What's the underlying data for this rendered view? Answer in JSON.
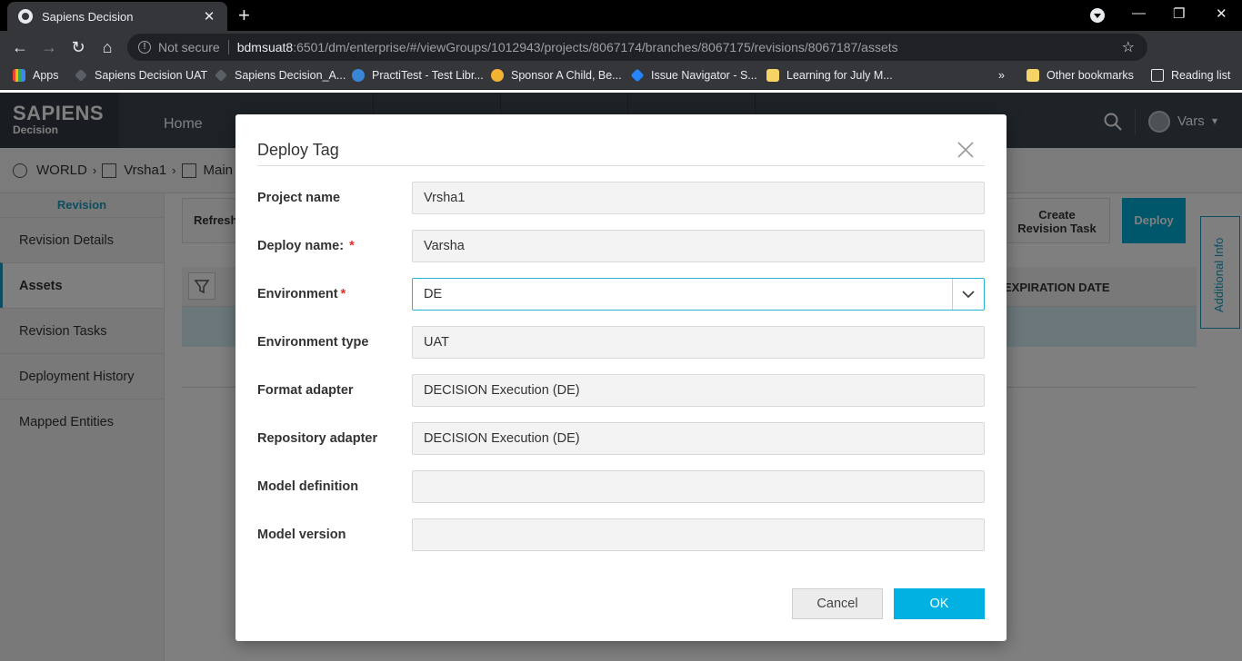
{
  "browser": {
    "tab_title": "Sapiens Decision",
    "url_warning": "Not secure",
    "url_host": "bdmsuat8",
    "url_rest": ":6501/dm/enterprise/#/viewGroups/1012943/projects/8067174/branches/8067175/revisions/8067187/assets",
    "bookmarks": [
      "Apps",
      "Sapiens Decision UAT",
      "Sapiens Decision_A...",
      "PractiTest - Test Libr...",
      "Sponsor A Child, Be...",
      "Issue Navigator - S...",
      "Learning for July M..."
    ],
    "more_bookmarks": "»",
    "other_bookmarks": "Other bookmarks",
    "reading_list": "Reading list"
  },
  "app": {
    "logo_top": "SAPIENS",
    "logo_bottom": "Decision",
    "nav_home": "Home",
    "user_name": "Vars",
    "breadcrumb": [
      "WORLD",
      "Vrsha1",
      "Main"
    ],
    "sidebar_header": "Revision",
    "sidebar_items": [
      "Revision Details",
      "Assets",
      "Revision Tasks",
      "Deployment History",
      "Mapped Entities"
    ],
    "refresh_label": "Refresh",
    "create_task_label": "Create\nRevision Task",
    "deploy_label": "Deploy",
    "additional_info": "Additional Info",
    "expiration_col": "EXPIRATION DATE"
  },
  "dialog": {
    "title": "Deploy Tag",
    "fields": {
      "project_name": {
        "label": "Project name",
        "value": "Vrsha1"
      },
      "deploy_name": {
        "label": "Deploy name:",
        "required": "*",
        "value": "Varsha"
      },
      "environment": {
        "label": "Environment",
        "required": "*",
        "value": "DE"
      },
      "environment_type": {
        "label": "Environment type",
        "value": "UAT"
      },
      "format_adapter": {
        "label": "Format adapter",
        "value": "DECISION Execution (DE)"
      },
      "repository_adapter": {
        "label": "Repository adapter",
        "value": "DECISION Execution (DE)"
      },
      "model_definition": {
        "label": "Model definition",
        "value": ""
      },
      "model_version": {
        "label": "Model version",
        "value": ""
      }
    },
    "cancel_label": "Cancel",
    "ok_label": "OK"
  },
  "colors": {
    "accent": "#00b1e1",
    "header_bg": "#3d4650",
    "required": "#e0302a"
  }
}
